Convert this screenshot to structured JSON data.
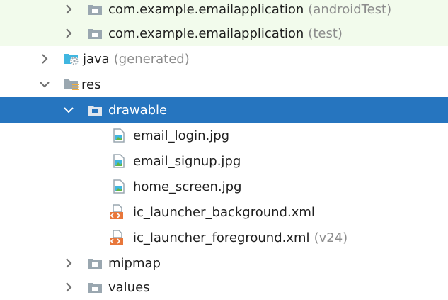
{
  "tree": {
    "items": [
      {
        "label": "com.example.emailapplication",
        "suffix": "(androidTest)",
        "icon": "package-folder-icon",
        "state": "collapsed"
      },
      {
        "label": "com.example.emailapplication",
        "suffix": "(test)",
        "icon": "package-folder-icon",
        "state": "collapsed"
      },
      {
        "label": "java",
        "suffix": "(generated)",
        "icon": "generated-java-folder-icon",
        "state": "collapsed"
      },
      {
        "label": "res",
        "suffix": "",
        "icon": "resource-folder-icon",
        "state": "expanded"
      },
      {
        "label": "drawable",
        "suffix": "",
        "icon": "folder-icon",
        "state": "expanded",
        "selected": true
      },
      {
        "label": "email_login.jpg",
        "suffix": "",
        "icon": "image-file-icon"
      },
      {
        "label": "email_signup.jpg",
        "suffix": "",
        "icon": "image-file-icon"
      },
      {
        "label": "home_screen.jpg",
        "suffix": "",
        "icon": "image-file-icon"
      },
      {
        "label": "ic_launcher_background.xml",
        "suffix": "",
        "icon": "xml-file-icon"
      },
      {
        "label": "ic_launcher_foreground.xml",
        "suffix": "(v24)",
        "icon": "xml-file-icon"
      },
      {
        "label": "mipmap",
        "suffix": "",
        "icon": "folder-icon",
        "state": "collapsed"
      },
      {
        "label": "values",
        "suffix": "",
        "icon": "folder-icon",
        "state": "collapsed"
      }
    ]
  },
  "colors": {
    "selection": "#2675bf",
    "row_tint": "#f2fbec",
    "folder": "#9aa7b0",
    "image_file": "#40b6e0",
    "xml_badge": "#e8773b",
    "secondary_text": "#8c8c8c"
  }
}
